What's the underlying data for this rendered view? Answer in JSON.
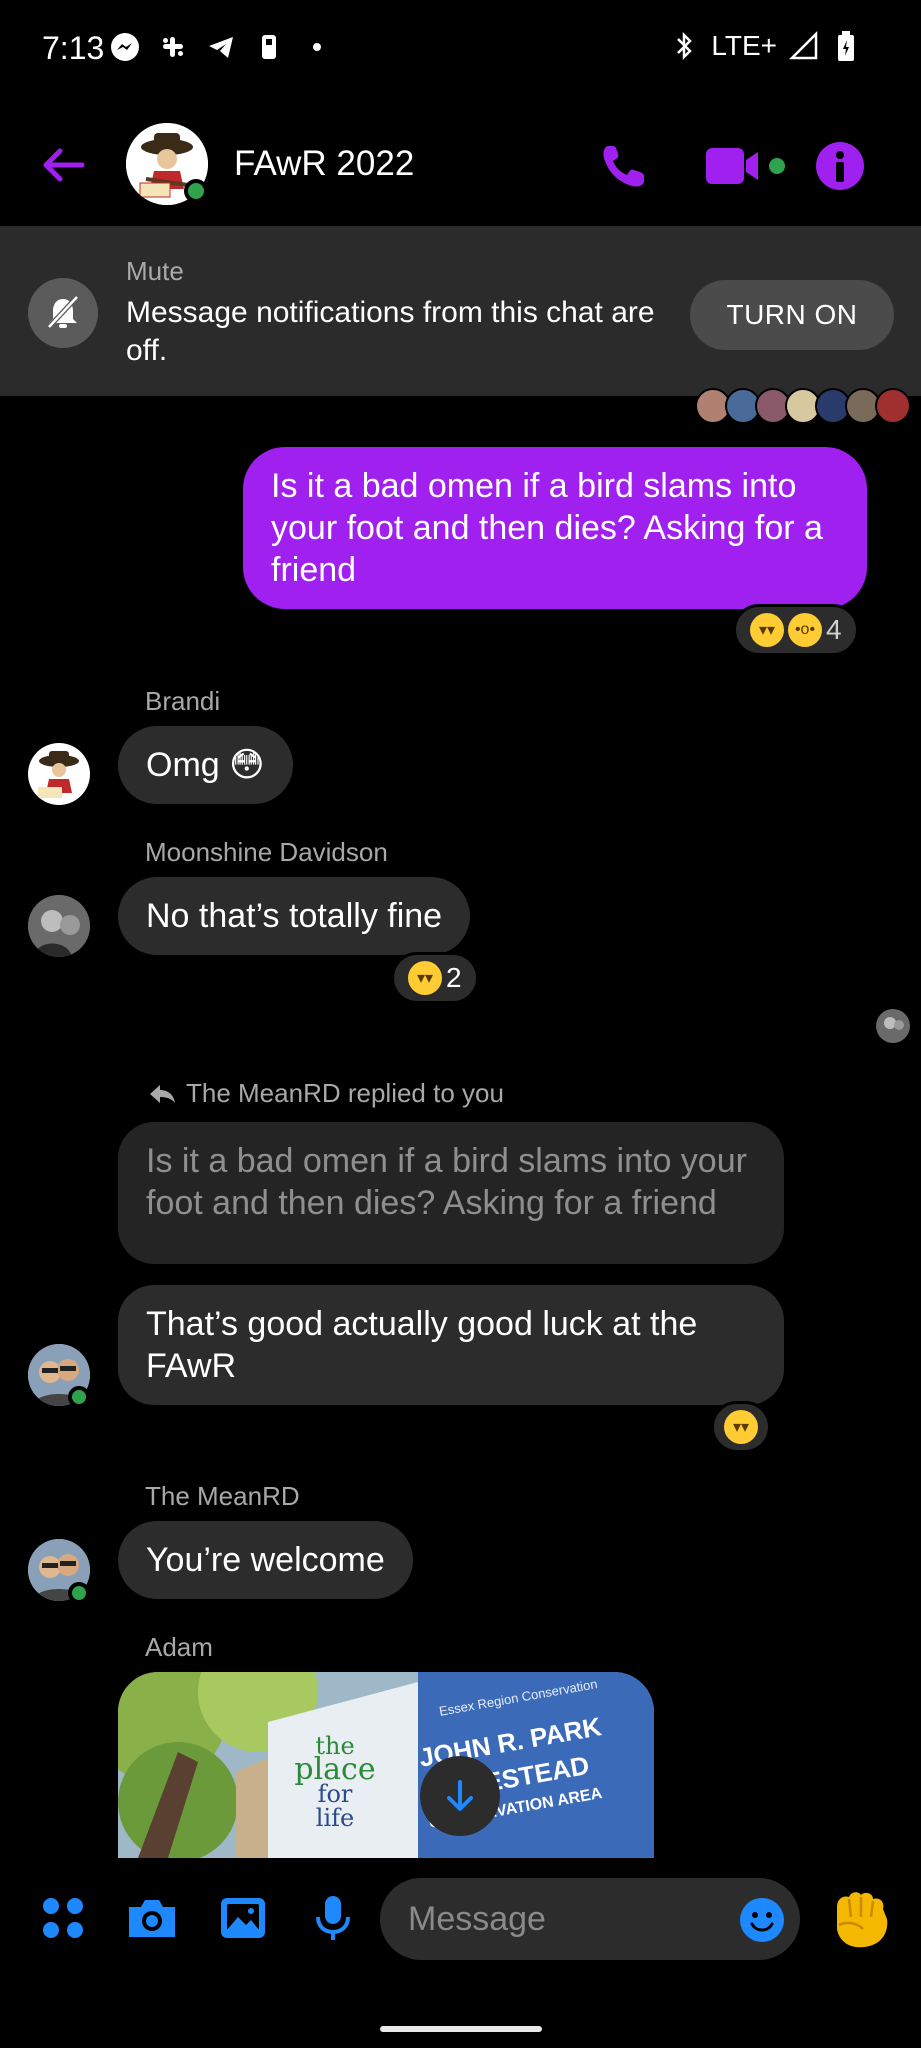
{
  "status_bar": {
    "time": "7:13",
    "network": "LTE+",
    "icons": [
      "messenger-icon",
      "slack-icon",
      "telegram-icon",
      "phone-app-icon",
      "dot-icon",
      "bluetooth-icon",
      "signal-icon",
      "battery-icon"
    ]
  },
  "header": {
    "title": "FAwR 2022",
    "accent_color": "#a020f0"
  },
  "mute_banner": {
    "label": "Mute",
    "text": "Message notifications from this chat are off.",
    "button": "TURN ON"
  },
  "messages": [
    {
      "type": "outgoing",
      "text": "Is it a bad omen if a bird slams into your foot and then dies? Asking for a friend",
      "reactions_count": "4"
    },
    {
      "type": "incoming",
      "sender": "Brandi",
      "text": "Omg 😳"
    },
    {
      "type": "incoming",
      "sender": "Moonshine Davidson",
      "text": "No that’s totally fine",
      "reactions_count": "2"
    },
    {
      "type": "reply",
      "reply_label": "The MeanRD replied to you",
      "quoted": "Is it a bad omen if a bird slams into your foot and then dies? Asking for a friend",
      "text": "That’s good actually good luck at the FAwR"
    },
    {
      "type": "incoming",
      "sender": "The MeanRD",
      "text": "You’re welcome"
    },
    {
      "type": "image",
      "sender": "Adam",
      "image_text": {
        "line1": "Essex Region Conservation",
        "line2": "JOHN R. PARK",
        "line3": "HOMESTEAD",
        "line4": "CONSERVATION AREA",
        "slogan": [
          "the",
          "place",
          "for",
          "life"
        ]
      }
    }
  ],
  "composer": {
    "placeholder": "Message"
  },
  "colors": {
    "outgoing_bubble": "#a020f0",
    "incoming_bubble": "#2c2c2c",
    "blue_icons": "#1e88ff",
    "online": "#31a24c"
  }
}
